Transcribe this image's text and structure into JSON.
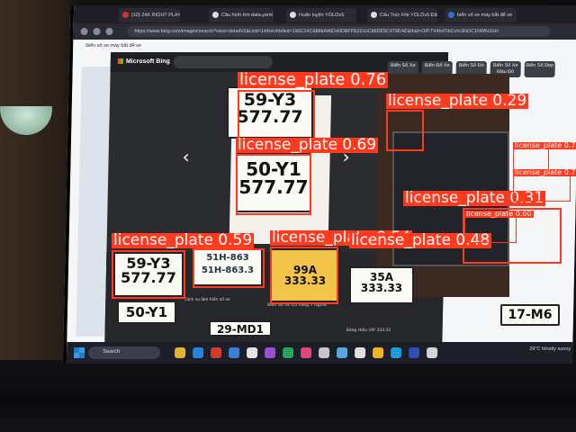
{
  "browser": {
    "tabs": [
      "(10) 24K RIGHT PLAY",
      "Câu hình tìm data.yaml",
      "Huấn luyện YOLOv5",
      "Cấu Trúc File YOLOv5 Đăng",
      "biển số xe máy bắt để xe"
    ],
    "address": "https://www.bing.com/images/search?view=detailV2&ccid=144mUhbIkid=190C24C6886A96D40DBFFB2010C86DE5C479EAE&thid=OIP.T44hrl7ibCchr3NOC1NWNJGH"
  },
  "page": {
    "search_label": "Biển số xe máy bắt để xe",
    "title": "Biển Số Xe"
  },
  "lightbox": {
    "logo": "Microsoft Bing",
    "chips": [
      "Biển Số Xe",
      "Biển Đổ Xe",
      "Biển Số Đỏ",
      "Biển Số Xe Màu Đỏ",
      "Biển Số Đẹp"
    ],
    "prev_arrow": "‹",
    "next_arrow": "›",
    "thumb_caption_1": "Dịch vụ làm biển số xe",
    "thumb_caption_2": "Biển Số Xe Có Vàng Ý Nghĩa",
    "thumb_caption_3": "Bảng Hiệu VIP 333.33"
  },
  "plates": [
    {
      "line1": "59-Y3",
      "line2": "577.77"
    },
    {
      "line1": "50-Y1",
      "line2": "577.77"
    },
    {
      "line1": "59-Y3",
      "line2": "577.77"
    },
    {
      "line1": "50-Y1",
      "line2": ""
    },
    {
      "line1": "51H-863",
      "line2": "51H-863.3"
    },
    {
      "line1": "99A",
      "line2": "333.33"
    },
    {
      "line1": "35A",
      "line2": "333.33"
    },
    {
      "line1": "17-M6",
      "line2": ""
    },
    {
      "line1": "29-MD1",
      "line2": ""
    }
  ],
  "taskbar": {
    "search": "Search",
    "weather": "29°C Mostly sunny"
  },
  "detections": [
    {
      "label": "license_plate 0.76"
    },
    {
      "label": "license_plate 0.29"
    },
    {
      "label": "license_plate 0.69"
    },
    {
      "label": "license_plate 0.31"
    },
    {
      "label": "license_plate 0.59"
    },
    {
      "label": "license_plate 0.54"
    },
    {
      "label": "license_plate 0.48"
    },
    {
      "label": "license_plate 0.7"
    },
    {
      "label": "license_plate 0.7"
    },
    {
      "label": "license_plate 0.60"
    }
  ],
  "colors": {
    "detection": "#ff3a1e",
    "label_text": "#ffffff"
  }
}
